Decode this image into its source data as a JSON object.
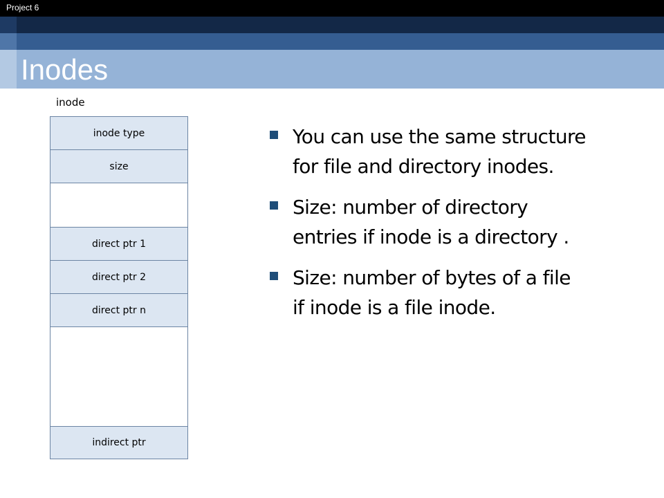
{
  "header": {
    "label": "Project 6"
  },
  "slide": {
    "title": "Inodes"
  },
  "diagram": {
    "caption": "inode",
    "fields": {
      "type": "inode type",
      "size": "size",
      "direct1": "direct ptr 1",
      "direct2": "direct ptr 2",
      "directn": "direct ptr n",
      "indirect": "indirect ptr"
    }
  },
  "bullets": [
    "You can use the same structure for file and directory inodes.",
    "Size: number of directory entries if inode is a directory .",
    "Size: number of bytes of a file if inode is a file inode."
  ],
  "colors": {
    "header_black": "#000000",
    "header_navy": "#132847",
    "header_mid": "#355d91",
    "title_band": "#95b3d7",
    "cell_fill": "#dce6f2",
    "bullet_marker": "#1f4e79"
  }
}
